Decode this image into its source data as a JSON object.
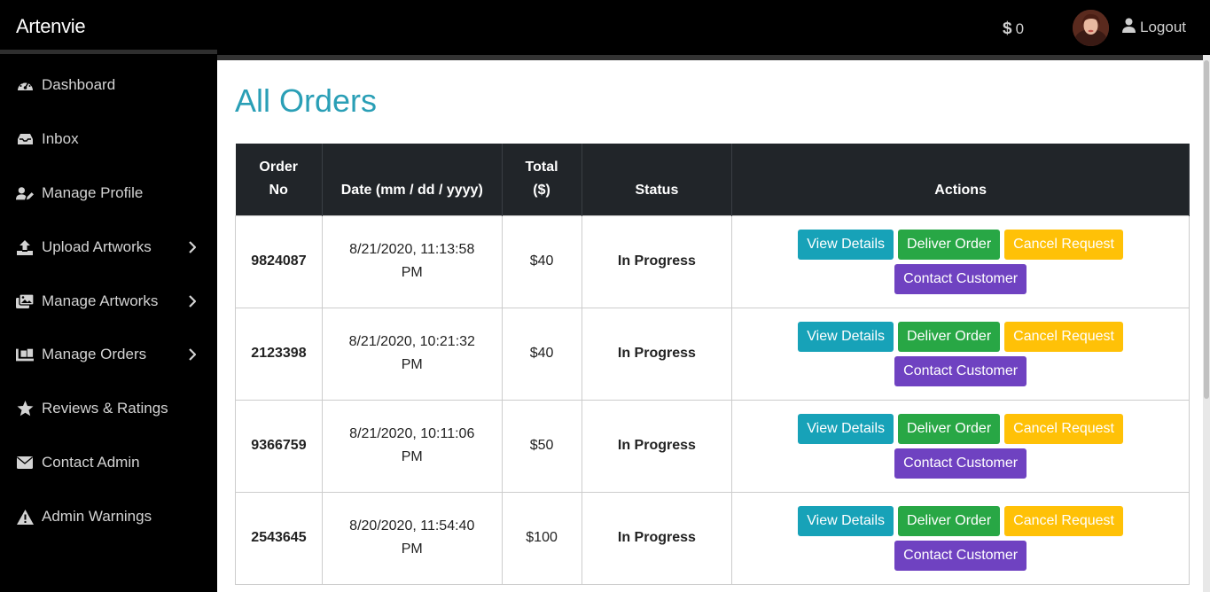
{
  "app": {
    "brand": "Artenvie",
    "balance": "0",
    "balance_symbol": "$",
    "logout_label": "Logout"
  },
  "sidebar": {
    "items": [
      {
        "label": "Dashboard",
        "icon": "dashboard-icon",
        "has_submenu": false
      },
      {
        "label": "Inbox",
        "icon": "inbox-icon",
        "has_submenu": false
      },
      {
        "label": "Manage Profile",
        "icon": "user-edit-icon",
        "has_submenu": false
      },
      {
        "label": "Upload Artworks",
        "icon": "upload-icon",
        "has_submenu": true
      },
      {
        "label": "Manage Artworks",
        "icon": "images-icon",
        "has_submenu": true
      },
      {
        "label": "Manage Orders",
        "icon": "dolly-icon",
        "has_submenu": true
      },
      {
        "label": "Reviews & Ratings",
        "icon": "star-icon",
        "has_submenu": false
      },
      {
        "label": "Contact Admin",
        "icon": "envelope-icon",
        "has_submenu": false
      },
      {
        "label": "Admin Warnings",
        "icon": "warning-icon",
        "has_submenu": false
      }
    ]
  },
  "page": {
    "title": "All Orders"
  },
  "table": {
    "headers": {
      "order_no_1": "Order",
      "order_no_2": "No",
      "date": "Date (mm / dd / yyyy)",
      "total_1": "Total",
      "total_2": "($)",
      "status": "Status",
      "actions": "Actions"
    },
    "rows": [
      {
        "order_no": "9824087",
        "date_1": "8/21/2020, 11:13:58",
        "date_2": "PM",
        "total": "$40",
        "status": "In Progress"
      },
      {
        "order_no": "2123398",
        "date_1": "8/21/2020, 10:21:32",
        "date_2": "PM",
        "total": "$40",
        "status": "In Progress"
      },
      {
        "order_no": "9366759",
        "date_1": "8/21/2020, 10:11:06",
        "date_2": "PM",
        "total": "$50",
        "status": "In Progress"
      },
      {
        "order_no": "2543645",
        "date_1": "8/20/2020, 11:54:40",
        "date_2": "PM",
        "total": "$100",
        "status": "In Progress"
      }
    ],
    "actions": {
      "view": "View Details",
      "deliver": "Deliver Order",
      "cancel": "Cancel Request",
      "contact": "Contact Customer"
    }
  },
  "colors": {
    "accent": "#2a9fb6",
    "view": "#17a2b8",
    "deliver": "#28a745",
    "cancel": "#ffc107",
    "contact": "#6f42c1",
    "header_bg": "#212529"
  }
}
